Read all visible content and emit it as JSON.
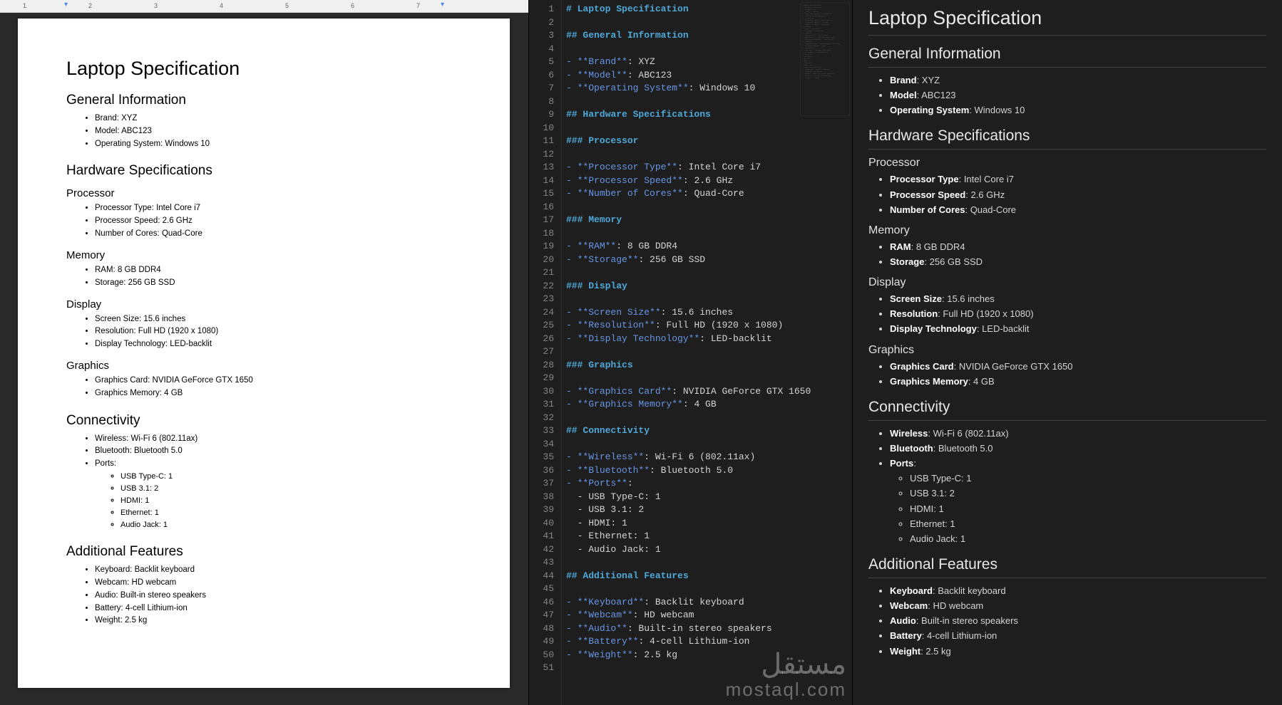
{
  "doc": {
    "title": "Laptop Specification",
    "sections": [
      {
        "heading": "General Information",
        "items": [
          "Brand: XYZ",
          "Model: ABC123",
          "Operating System: Windows 10"
        ]
      },
      {
        "heading": "Hardware Specifications",
        "subsections": [
          {
            "heading": "Processor",
            "items": [
              "Processor Type: Intel Core i7",
              "Processor Speed: 2.6 GHz",
              "Number of Cores: Quad-Core"
            ]
          },
          {
            "heading": "Memory",
            "items": [
              "RAM: 8 GB DDR4",
              "Storage: 256 GB SSD"
            ]
          },
          {
            "heading": "Display",
            "items": [
              "Screen Size: 15.6 inches",
              "Resolution: Full HD (1920 x 1080)",
              "Display Technology: LED-backlit"
            ]
          },
          {
            "heading": "Graphics",
            "items": [
              "Graphics Card: NVIDIA GeForce GTX 1650",
              "Graphics Memory: 4 GB"
            ]
          }
        ]
      },
      {
        "heading": "Connectivity",
        "items": [
          "Wireless: Wi-Fi 6 (802.11ax)",
          "Bluetooth: Bluetooth 5.0",
          "Ports:"
        ],
        "nested": [
          "USB Type-C: 1",
          "USB 3.1: 2",
          "HDMI: 1",
          "Ethernet: 1",
          "Audio Jack: 1"
        ]
      },
      {
        "heading": "Additional Features",
        "items": [
          "Keyboard: Backlit keyboard",
          "Webcam: HD webcam",
          "Audio: Built-in stereo speakers",
          "Battery: 4-cell Lithium-ion",
          "Weight: 2.5 kg"
        ]
      }
    ]
  },
  "markdown_lines": [
    {
      "type": "h1",
      "text": "# Laptop Specification"
    },
    {
      "type": "blank",
      "text": ""
    },
    {
      "type": "h2",
      "text": "## General Information"
    },
    {
      "type": "blank",
      "text": ""
    },
    {
      "type": "li",
      "bold": "Brand",
      "rest": ": XYZ"
    },
    {
      "type": "li",
      "bold": "Model",
      "rest": ": ABC123"
    },
    {
      "type": "li",
      "bold": "Operating System",
      "rest": ": Windows 10"
    },
    {
      "type": "blank",
      "text": ""
    },
    {
      "type": "h2",
      "text": "## Hardware Specifications"
    },
    {
      "type": "blank",
      "text": ""
    },
    {
      "type": "h3",
      "text": "### Processor"
    },
    {
      "type": "blank",
      "text": ""
    },
    {
      "type": "li",
      "bold": "Processor Type",
      "rest": ": Intel Core i7"
    },
    {
      "type": "li",
      "bold": "Processor Speed",
      "rest": ": 2.6 GHz"
    },
    {
      "type": "li",
      "bold": "Number of Cores",
      "rest": ": Quad-Core"
    },
    {
      "type": "blank",
      "text": ""
    },
    {
      "type": "h3",
      "text": "### Memory"
    },
    {
      "type": "blank",
      "text": ""
    },
    {
      "type": "li",
      "bold": "RAM",
      "rest": ": 8 GB DDR4"
    },
    {
      "type": "li",
      "bold": "Storage",
      "rest": ": 256 GB SSD"
    },
    {
      "type": "blank",
      "text": ""
    },
    {
      "type": "h3",
      "text": "### Display"
    },
    {
      "type": "blank",
      "text": ""
    },
    {
      "type": "li",
      "bold": "Screen Size",
      "rest": ": 15.6 inches"
    },
    {
      "type": "li",
      "bold": "Resolution",
      "rest": ": Full HD (1920 x 1080)"
    },
    {
      "type": "li",
      "bold": "Display Technology",
      "rest": ": LED-backlit"
    },
    {
      "type": "blank",
      "text": ""
    },
    {
      "type": "h3",
      "text": "### Graphics"
    },
    {
      "type": "blank",
      "text": ""
    },
    {
      "type": "li",
      "bold": "Graphics Card",
      "rest": ": NVIDIA GeForce GTX 1650"
    },
    {
      "type": "li",
      "bold": "Graphics Memory",
      "rest": ": 4 GB"
    },
    {
      "type": "blank",
      "text": ""
    },
    {
      "type": "h2",
      "text": "## Connectivity"
    },
    {
      "type": "blank",
      "text": ""
    },
    {
      "type": "li",
      "bold": "Wireless",
      "rest": ": Wi-Fi 6 (802.11ax)"
    },
    {
      "type": "li",
      "bold": "Bluetooth",
      "rest": ": Bluetooth 5.0"
    },
    {
      "type": "li",
      "bold": "Ports",
      "rest": ":"
    },
    {
      "type": "sub",
      "text": "  - USB Type-C: 1"
    },
    {
      "type": "sub",
      "text": "  - USB 3.1: 2"
    },
    {
      "type": "sub",
      "text": "  - HDMI: 1"
    },
    {
      "type": "sub",
      "text": "  - Ethernet: 1"
    },
    {
      "type": "sub",
      "text": "  - Audio Jack: 1"
    },
    {
      "type": "blank",
      "text": ""
    },
    {
      "type": "h2",
      "text": "## Additional Features"
    },
    {
      "type": "blank",
      "text": ""
    },
    {
      "type": "li",
      "bold": "Keyboard",
      "rest": ": Backlit keyboard"
    },
    {
      "type": "li",
      "bold": "Webcam",
      "rest": ": HD webcam"
    },
    {
      "type": "li",
      "bold": "Audio",
      "rest": ": Built-in stereo speakers"
    },
    {
      "type": "li",
      "bold": "Battery",
      "rest": ": 4-cell Lithium-ion"
    },
    {
      "type": "li",
      "bold": "Weight",
      "rest": ": 2.5 kg"
    },
    {
      "type": "blank",
      "text": ""
    }
  ],
  "preview": {
    "title": "Laptop Specification",
    "sections": [
      {
        "heading": "General Information",
        "items": [
          {
            "b": "Brand",
            "v": ": XYZ"
          },
          {
            "b": "Model",
            "v": ": ABC123"
          },
          {
            "b": "Operating System",
            "v": ": Windows 10"
          }
        ]
      },
      {
        "heading": "Hardware Specifications",
        "subsections": [
          {
            "heading": "Processor",
            "items": [
              {
                "b": "Processor Type",
                "v": ": Intel Core i7"
              },
              {
                "b": "Processor Speed",
                "v": ": 2.6 GHz"
              },
              {
                "b": "Number of Cores",
                "v": ": Quad-Core"
              }
            ]
          },
          {
            "heading": "Memory",
            "items": [
              {
                "b": "RAM",
                "v": ": 8 GB DDR4"
              },
              {
                "b": "Storage",
                "v": ": 256 GB SSD"
              }
            ]
          },
          {
            "heading": "Display",
            "items": [
              {
                "b": "Screen Size",
                "v": ": 15.6 inches"
              },
              {
                "b": "Resolution",
                "v": ": Full HD (1920 x 1080)"
              },
              {
                "b": "Display Technology",
                "v": ": LED-backlit"
              }
            ]
          },
          {
            "heading": "Graphics",
            "items": [
              {
                "b": "Graphics Card",
                "v": ": NVIDIA GeForce GTX 1650"
              },
              {
                "b": "Graphics Memory",
                "v": ": 4 GB"
              }
            ]
          }
        ]
      },
      {
        "heading": "Connectivity",
        "items": [
          {
            "b": "Wireless",
            "v": ": Wi-Fi 6 (802.11ax)"
          },
          {
            "b": "Bluetooth",
            "v": ": Bluetooth 5.0"
          },
          {
            "b": "Ports",
            "v": ":"
          }
        ],
        "nested": [
          "USB Type-C: 1",
          "USB 3.1: 2",
          "HDMI: 1",
          "Ethernet: 1",
          "Audio Jack: 1"
        ]
      },
      {
        "heading": "Additional Features",
        "items": [
          {
            "b": "Keyboard",
            "v": ": Backlit keyboard"
          },
          {
            "b": "Webcam",
            "v": ": HD webcam"
          },
          {
            "b": "Audio",
            "v": ": Built-in stereo speakers"
          },
          {
            "b": "Battery",
            "v": ": 4-cell Lithium-ion"
          },
          {
            "b": "Weight",
            "v": ": 2.5 kg"
          }
        ]
      }
    ]
  },
  "ruler_numbers": [
    "1",
    "2",
    "3",
    "4",
    "5",
    "6",
    "7"
  ],
  "watermark": {
    "arabic": "مستقل",
    "latin": "mostaql.com"
  }
}
